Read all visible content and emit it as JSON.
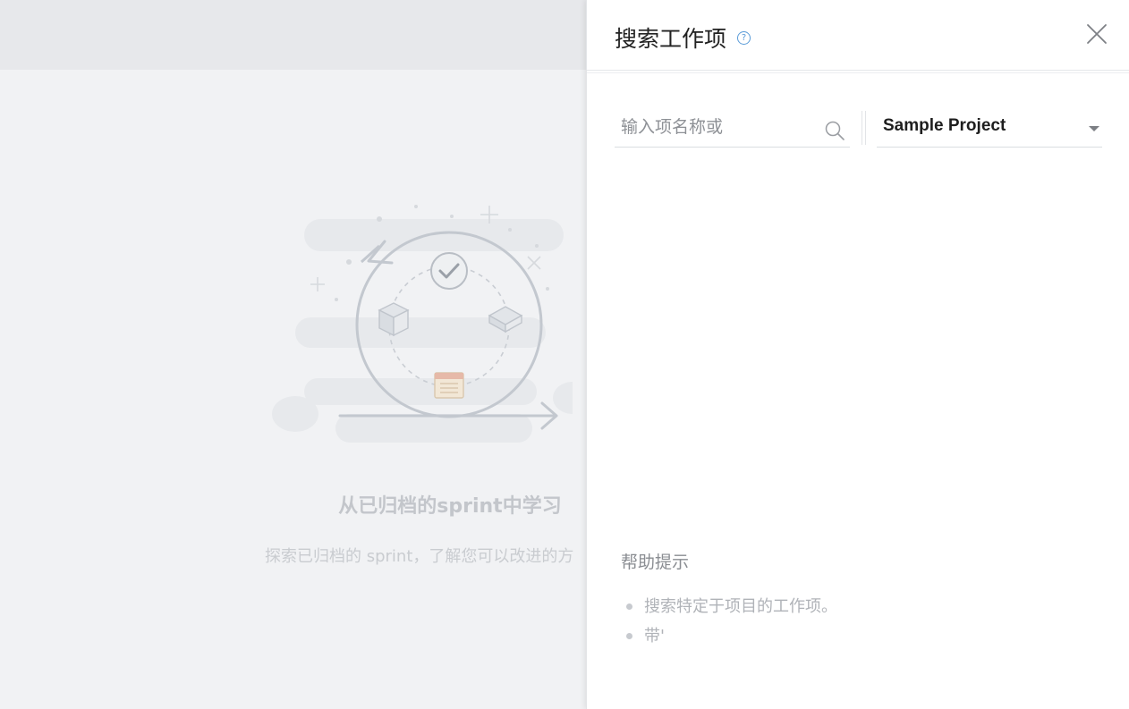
{
  "background": {
    "title": "从已归档的sprint中学习",
    "description": "探索已归档的 sprint，了解您可以改进的方"
  },
  "panel": {
    "title": "搜索工作项",
    "help_icon_glyph": "?",
    "search": {
      "placeholder": "输入项名称或",
      "value": ""
    },
    "project_select": {
      "selected": "Sample Project"
    },
    "tips": {
      "title": "帮助提示",
      "items": [
        "搜索特定于项目的工作项。",
        "带'"
      ]
    }
  },
  "colors": {
    "help_accent": "#5a9bd8",
    "panel_bg": "#ffffff",
    "overlay_bg": "#f1f2f4"
  }
}
